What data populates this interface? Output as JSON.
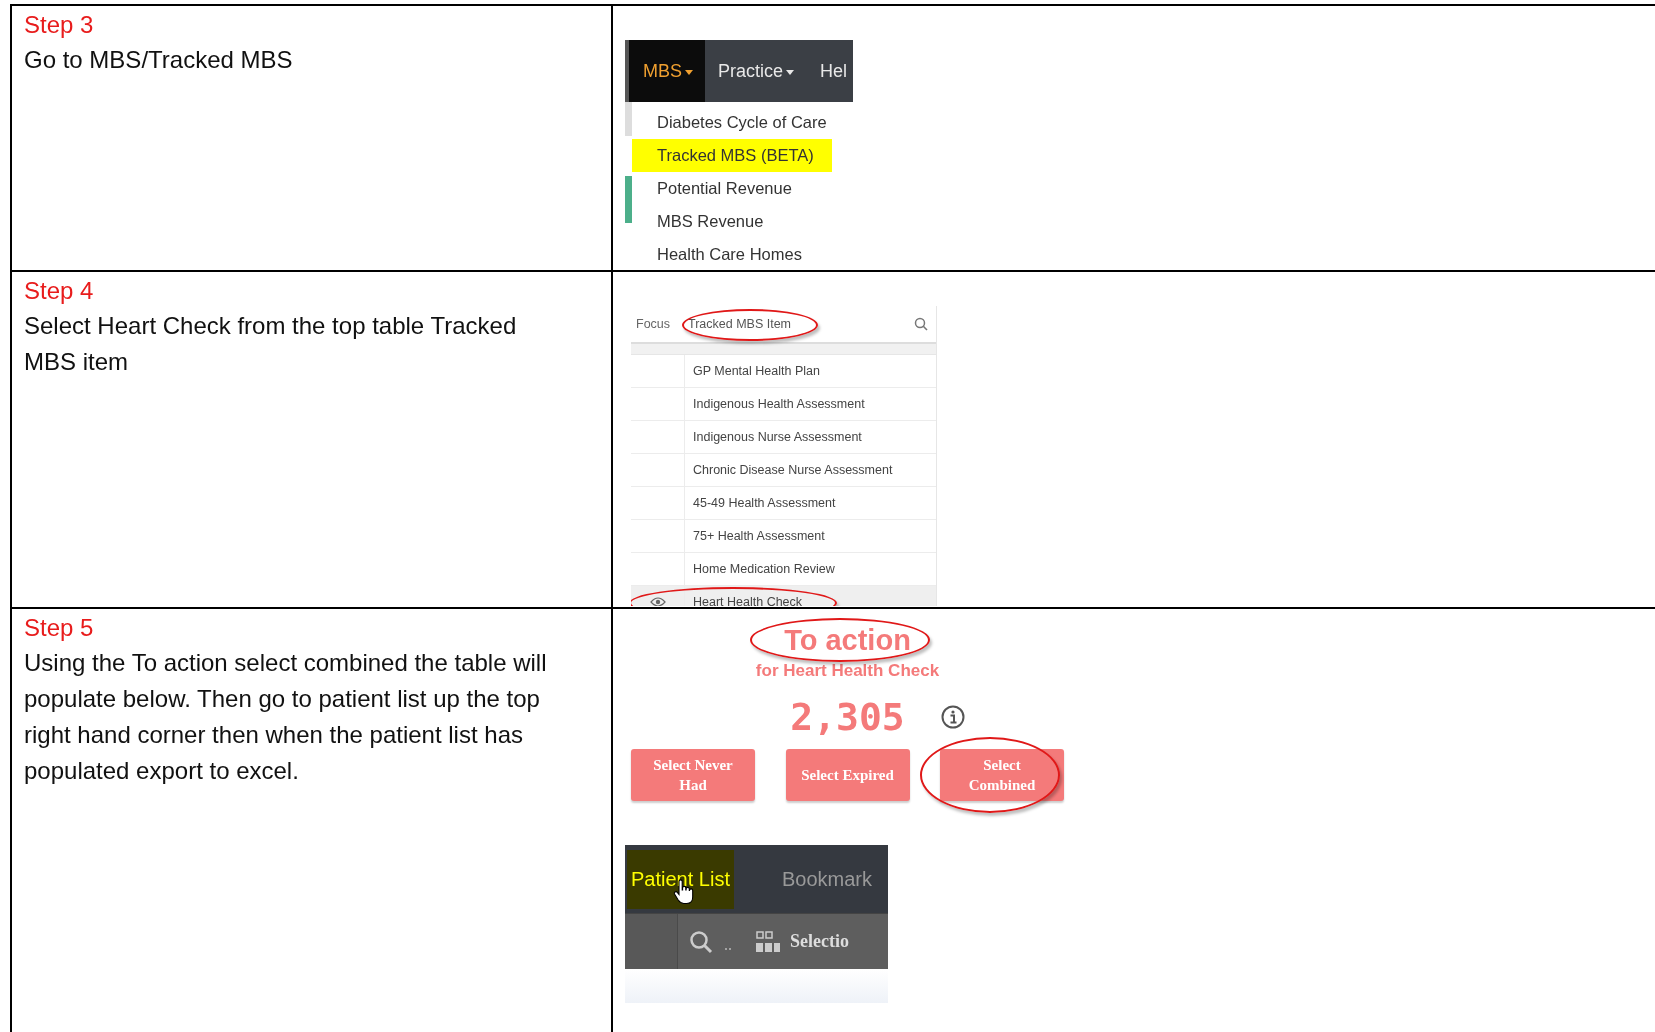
{
  "steps": [
    {
      "kind": "menu",
      "title": "Step 3",
      "instruction": "Go to MBS/Tracked MBS",
      "menu": {
        "tabs": [
          {
            "label": "MBS",
            "selected": true,
            "caret": true
          },
          {
            "label": "Practice",
            "selected": false,
            "caret": true
          },
          {
            "label": "Hel",
            "selected": false,
            "caret": false
          }
        ],
        "items": [
          {
            "label": "Diabetes Cycle of Care",
            "selected": false
          },
          {
            "label": "Tracked MBS (BETA)",
            "selected": true
          },
          {
            "label": "Potential Revenue",
            "selected": false
          },
          {
            "label": "MBS Revenue",
            "selected": false
          },
          {
            "label": "Health Care Homes",
            "selected": false
          }
        ]
      }
    },
    {
      "kind": "list",
      "title": "Step 4",
      "instruction": "Select Heart Check from the top table Tracked MBS item",
      "list": {
        "focus_label": "Focus",
        "header": "Tracked MBS Item",
        "header_circled": true,
        "rows": [
          {
            "label": "GP Mental Health Plan",
            "selected": false
          },
          {
            "label": "Indigenous Health Assessment",
            "selected": false
          },
          {
            "label": "Indigenous Nurse Assessment",
            "selected": false
          },
          {
            "label": "Chronic Disease Nurse Assessment",
            "selected": false
          },
          {
            "label": "45-49 Health Assessment",
            "selected": false
          },
          {
            "label": "75+ Health Assessment",
            "selected": false
          },
          {
            "label": "Home Medication Review",
            "selected": false
          },
          {
            "label": "Heart Health Check",
            "selected": true
          }
        ]
      }
    },
    {
      "kind": "action",
      "title": "Step 5",
      "instruction": "Using the To action select combined the table will populate below. Then go to patient list up the top right hand corner then when the patient list has populated export to excel.",
      "action": {
        "heading": "To action",
        "heading_circled": true,
        "subtitle": "for Heart Health Check",
        "count": "2,305",
        "buttons": [
          {
            "label": "Select Never Had",
            "circled": false
          },
          {
            "label": "Select Expired",
            "circled": false
          },
          {
            "label": "Select Combined",
            "circled": true
          }
        ],
        "tabs": [
          {
            "label": "Patient List",
            "selected": true
          },
          {
            "label": "Bookmark",
            "selected": false
          }
        ],
        "toolbar_label": "Selectio"
      }
    }
  ]
}
